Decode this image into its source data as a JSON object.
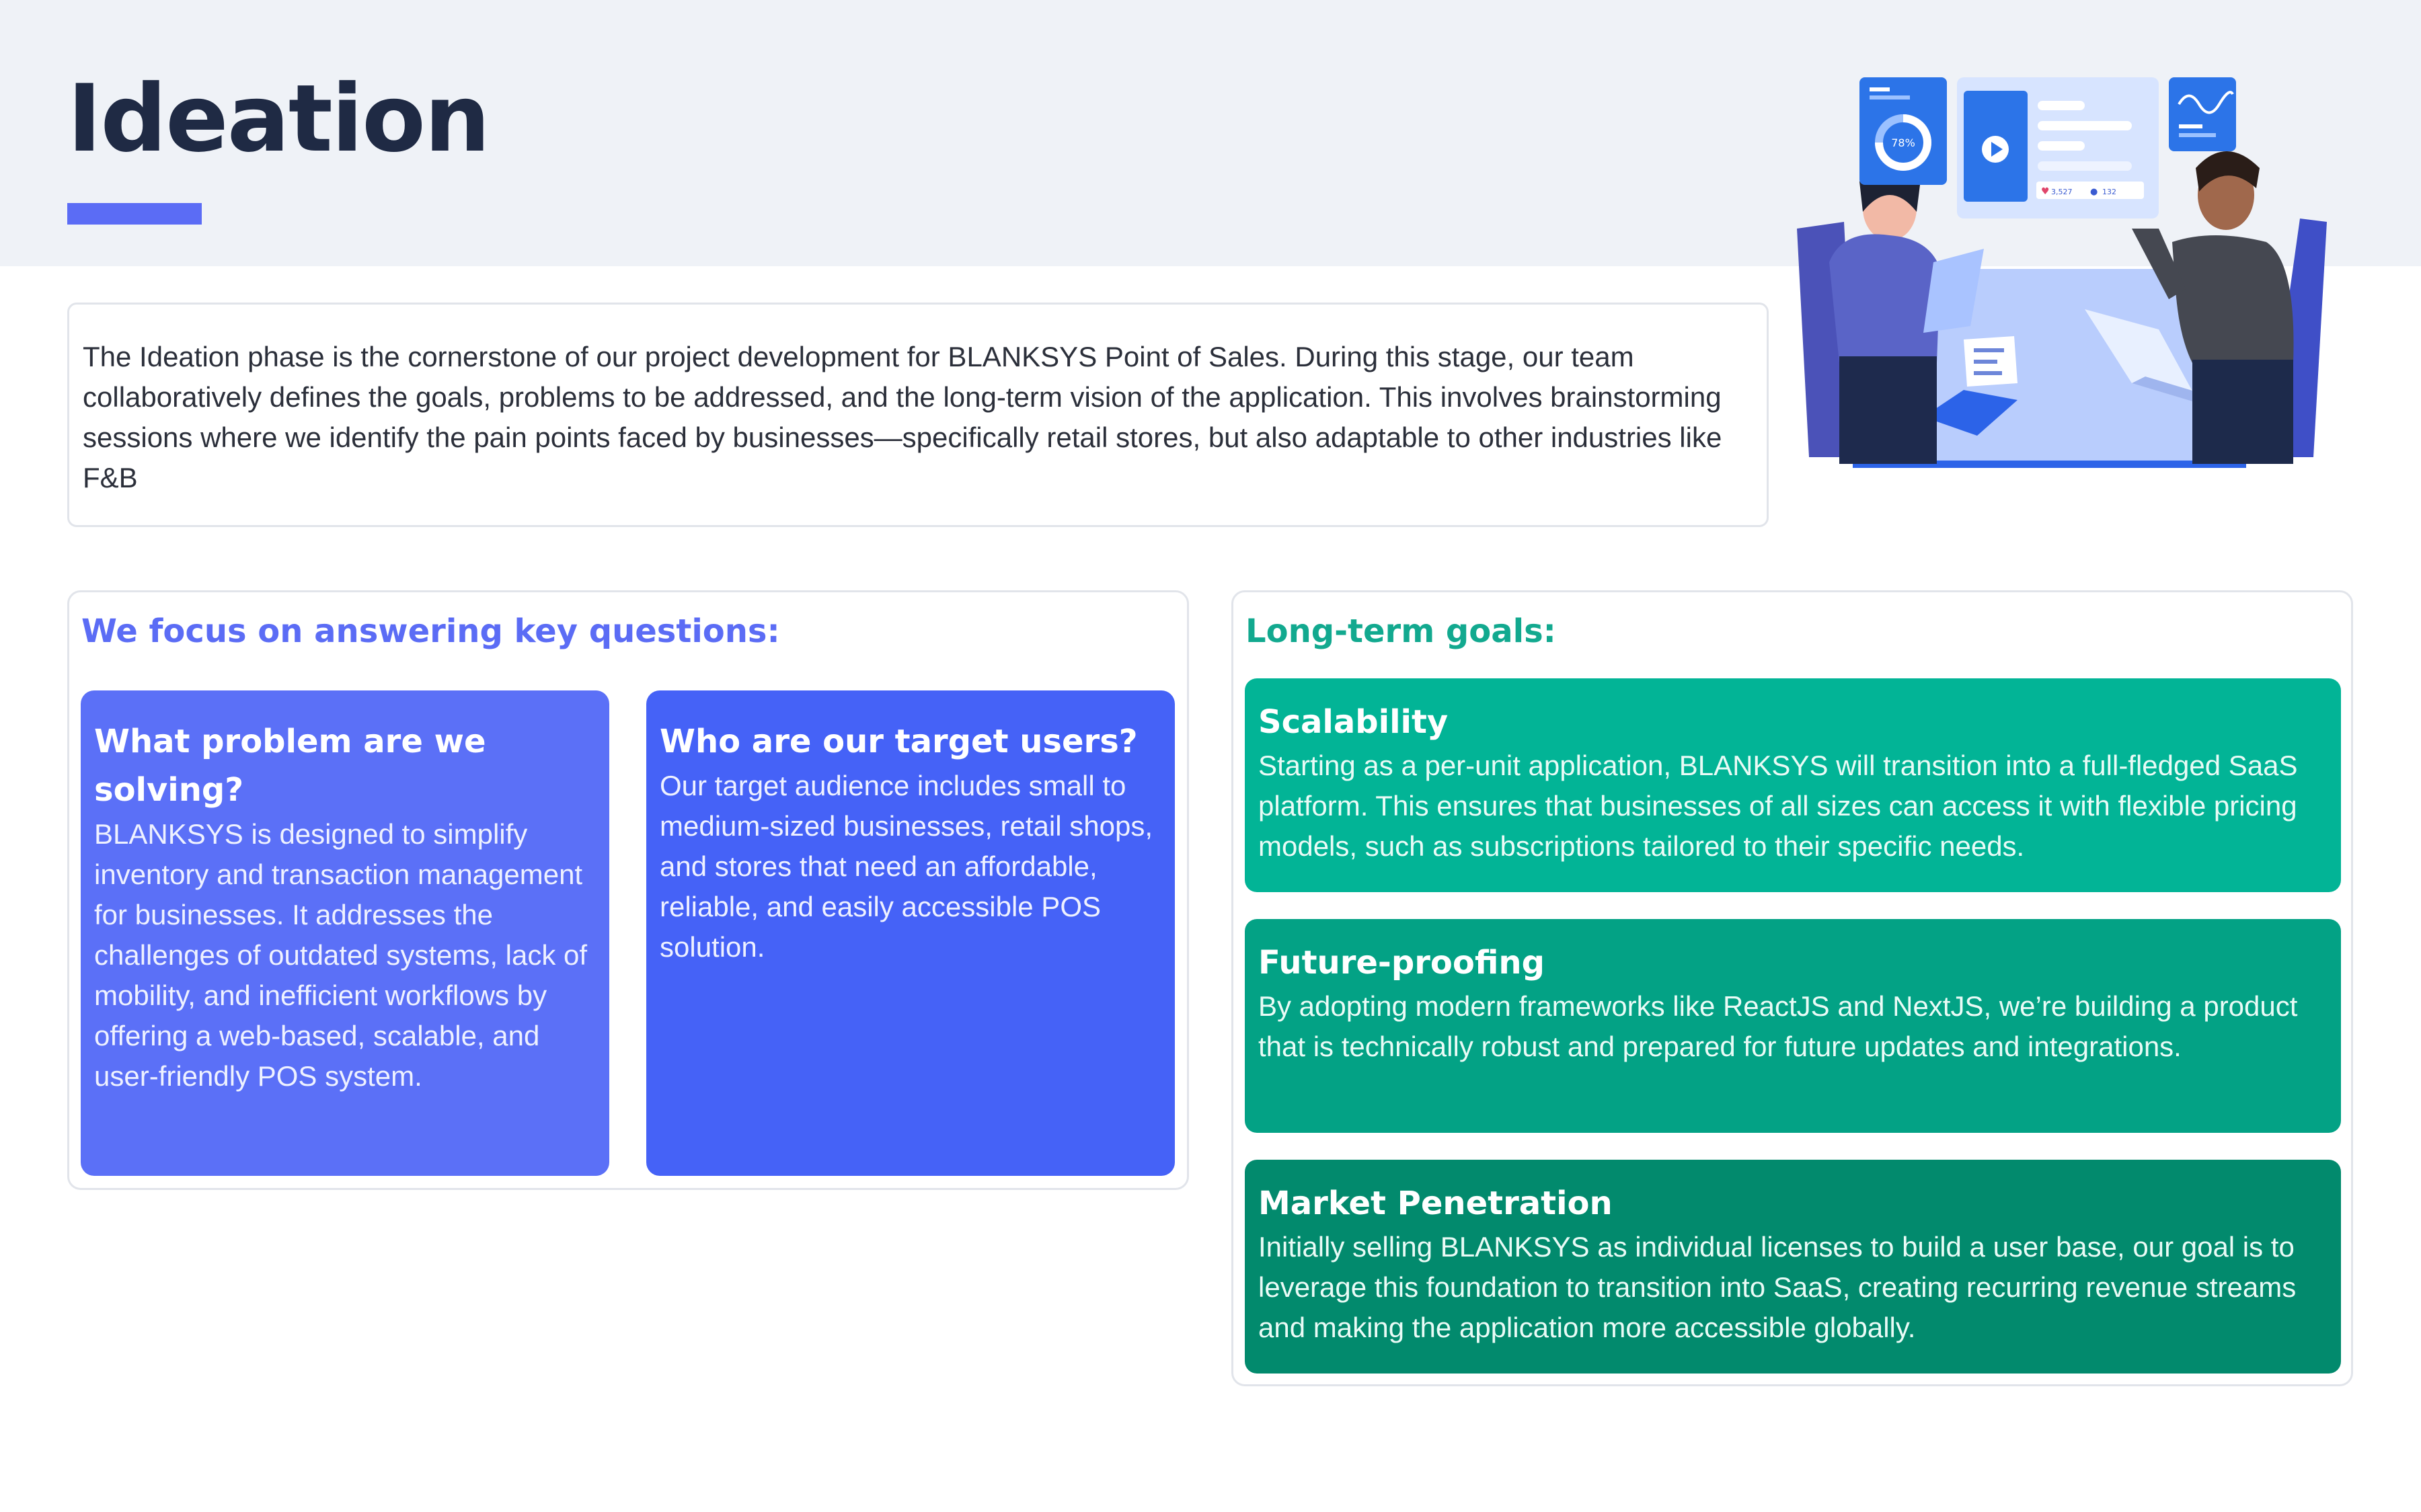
{
  "page": {
    "title": "Ideation",
    "accent_color": "#5b6cf5"
  },
  "intro": {
    "text": "The Ideation phase is the cornerstone of our project development for BLANKSYS Point of Sales. During this stage, our team collaboratively defines the goals, problems to be addressed, and the long-term vision of the application. This involves brainstorming sessions where we identify the pain points faced by businesses—specifically retail stores, but also adaptable to other industries like F&B"
  },
  "illustration": {
    "icon": "team-collaboration-illustration",
    "donut_label": "78%",
    "likes": "3,527",
    "comments": "132"
  },
  "questions": {
    "heading": "We focus on answering key questions:",
    "heading_color": "#5b6cf5",
    "cards": [
      {
        "title": "What problem are we solving?",
        "body": "BLANKSYS is designed to simplify inventory and transaction management for businesses. It addresses the challenges of outdated systems, lack of mobility, and inefficient workflows by offering a web-based, scalable, and user-friendly POS system.",
        "color": "#5b70f7"
      },
      {
        "title": "Who are our target users?",
        "body": "Our target audience includes small to medium-sized businesses, retail shops, and stores that need an affordable, reliable, and easily accessible POS solution.",
        "color": "#4562f7"
      }
    ]
  },
  "goals": {
    "heading": "Long-term goals:",
    "heading_color": "#12a98f",
    "cards": [
      {
        "title": "Scalability",
        "body": "Starting as a per-unit application, BLANKSYS will transition into a full-fledged SaaS platform. This ensures that businesses of all sizes can access it with flexible pricing models, such as subscriptions tailored to their specific needs.",
        "color": "#02b496"
      },
      {
        "title": "Future-proofing",
        "body": "By adopting modern frameworks like ReactJS and NextJS, we’re building a product that is technically robust and prepared for future updates and integrations.",
        "color": "#03a285"
      },
      {
        "title": "Market Penetration",
        "body": "Initially selling BLANKSYS as individual licenses to build a user base, our goal is to leverage this foundation to transition into SaaS, creating recurring revenue streams and making the application more accessible globally.",
        "color": "#028a6d"
      }
    ]
  }
}
